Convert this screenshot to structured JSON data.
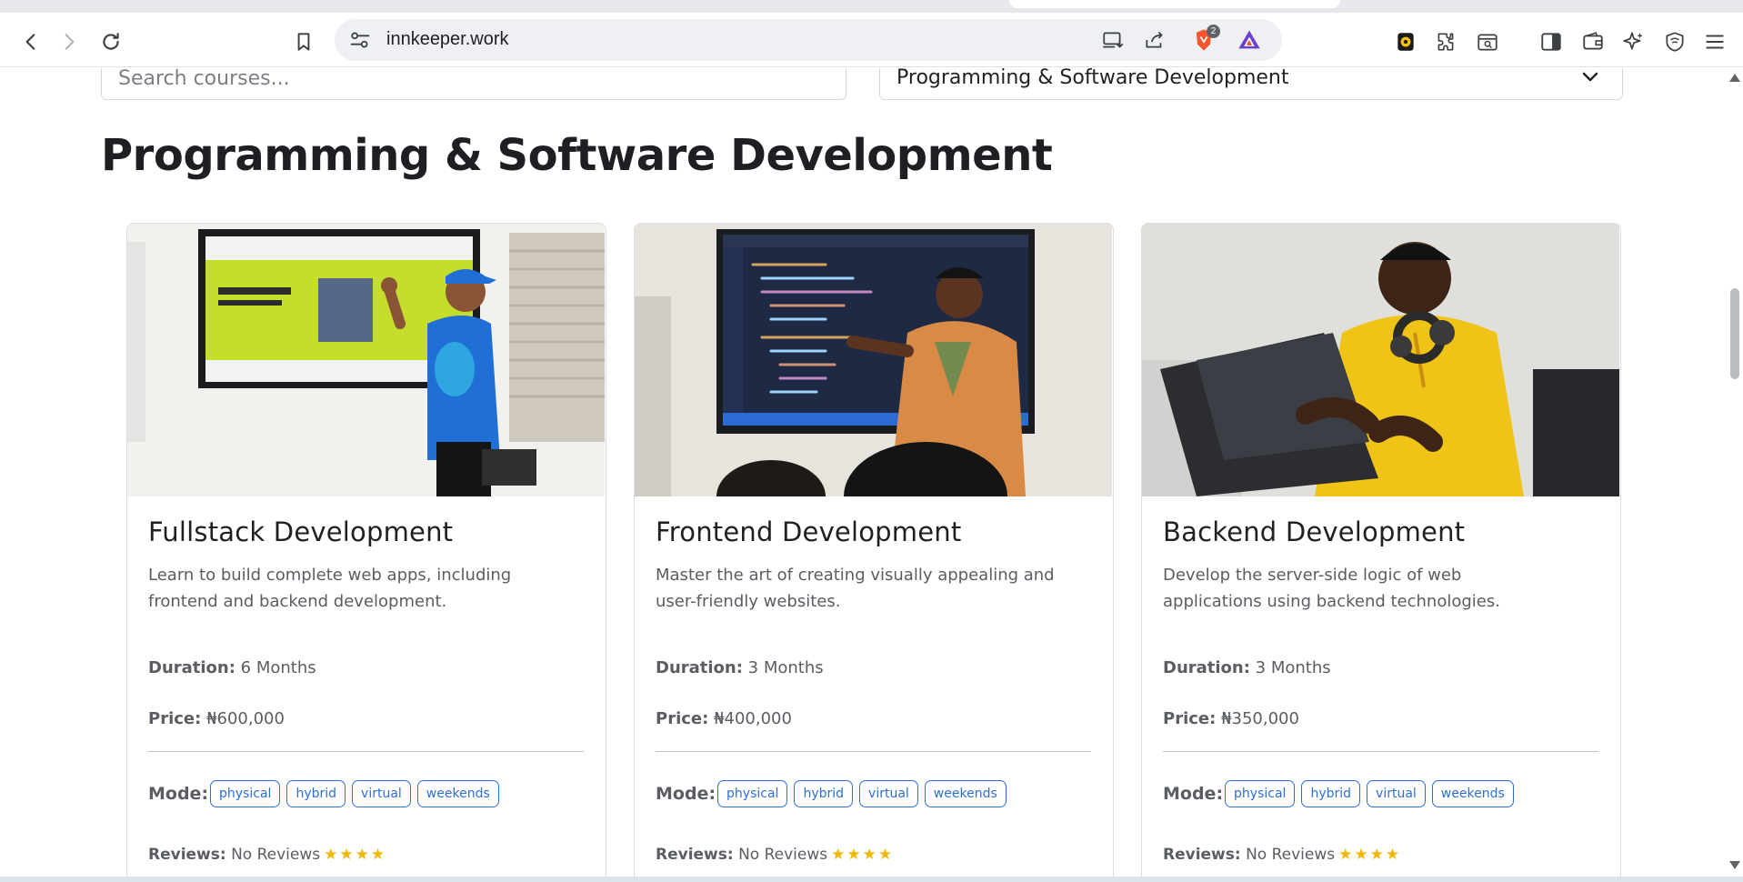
{
  "browser": {
    "url": "innkeeper.work",
    "brave_shield_count": "2",
    "icons": {
      "back": "back-arrow-icon",
      "forward": "forward-arrow-icon",
      "reload": "reload-icon",
      "bookmark": "bookmark-icon",
      "site_info": "site-settings-icon",
      "install": "install-app-icon",
      "share": "share-icon",
      "brave_shield": "brave-shield-icon",
      "brave_rewards": "brave-rewards-icon",
      "extension_wallet": "extension-icon",
      "extensions": "puzzle-icon",
      "tab_search": "tab-search-icon",
      "sidebar": "sidebar-icon",
      "wallet": "wallet-icon",
      "leo": "leo-ai-icon",
      "vpn": "vpn-shield-icon",
      "menu": "hamburger-menu-icon"
    }
  },
  "filters": {
    "search_placeholder": "Search courses...",
    "category_selected": "Programming & Software Development"
  },
  "section": {
    "title": "Programming & Software Development"
  },
  "labels": {
    "duration": "Duration:",
    "price": "Price:",
    "mode": "Mode:",
    "reviews": "Reviews:",
    "no_reviews": "No Reviews"
  },
  "courses": [
    {
      "title": "Fullstack Development",
      "description": "Learn to build complete web apps, including frontend and backend development.",
      "duration": "6 Months",
      "price": "₦600,000",
      "modes": [
        "physical",
        "hybrid",
        "virtual",
        "weekends"
      ],
      "stars": "★★★★"
    },
    {
      "title": "Frontend Development",
      "description": "Master the art of creating visually appealing and user-friendly websites.",
      "duration": "3 Months",
      "price": "₦400,000",
      "modes": [
        "physical",
        "hybrid",
        "virtual",
        "weekends"
      ],
      "stars": "★★★★"
    },
    {
      "title": "Backend Development",
      "description": "Develop the server-side logic of web applications using backend technologies.",
      "duration": "3 Months",
      "price": "₦350,000",
      "modes": [
        "physical",
        "hybrid",
        "virtual",
        "weekends"
      ],
      "stars": "★★★★"
    }
  ],
  "colors": {
    "tag_accent": "#2e6fd6",
    "star": "#f2b705",
    "heading": "#1e1f22"
  }
}
